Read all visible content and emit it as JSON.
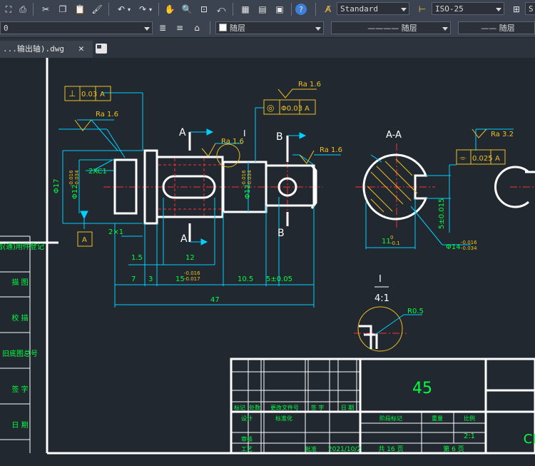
{
  "toolbar": {
    "text_style": "Standard",
    "dim_style": "ISO-25",
    "table_style_partial": "S"
  },
  "props": {
    "layer": "0",
    "color": "随层",
    "linetype": "———— 随层",
    "lineweight": "—— 随层"
  },
  "tab": {
    "filename": "...输出轴).dwg"
  },
  "drawing": {
    "tol_perp": "0.03",
    "tol_perp_ref": "A",
    "tol_conc": "Φ0.03",
    "tol_conc_ref": "A",
    "tol_sym": "0.025",
    "tol_sym_ref": "A",
    "ra_1": "Ra 1.6",
    "ra_2": "Ra 1.6",
    "ra_3": "Ra 1.6",
    "ra_4": "Ra 1.6",
    "ra_5": "Ra 3.2",
    "chamfer": "2XC1",
    "dia17": "Φ17",
    "dia12a": "Φ12",
    "dia12a_tol_up": "-0.016",
    "dia12a_tol_low": "-0.034",
    "dia12b": "Φ12",
    "dia12b_tol_up": "-0.016",
    "dia12b_tol_low": "-0.034",
    "datum_a": "A",
    "dim_2x1": "2×1",
    "dim_1_5": "1.5",
    "dim_12": "12",
    "dim_7": "7",
    "dim_3": "3",
    "dim_15": "15",
    "dim_15_tol_up": "-0.016",
    "dim_15_tol_low": "-0.017",
    "dim_10_5": "10.5",
    "dim_5": "5±0.05",
    "dim_47": "47",
    "sec_a_top": "A",
    "sec_a_bot": "A",
    "sec_b_top": "B",
    "sec_b_bot": "B",
    "detail_mark": "I",
    "section_title": "A-A",
    "dim_11": "11",
    "dim_11_tol_up": "0",
    "dim_11_tol_low": "-0.1",
    "dim_5_015": "5±0.015",
    "dim_14": "Φ14",
    "dim_14_tol_up": "-0.016",
    "dim_14_tol_low": "-0.034",
    "detail_title": "I",
    "detail_scale": "4:1",
    "detail_r": "R0.5"
  },
  "side_table": [
    "借(通)用件登记",
    "描 图",
    "校 描",
    "旧底图总号",
    "签 字",
    "日 期"
  ],
  "title_block": {
    "material": "45",
    "h_biaoji": "标记",
    "h_chushu": "处数",
    "h_fenqu": "更改文件号",
    "h_qianzi": "签 字",
    "h_riqi": "日 期",
    "sheji": "设计",
    "biaozhunhua": "标准化",
    "jieduan": "阶段标记",
    "zhongliang": "重量",
    "bili": "比例",
    "scale": "2:1",
    "shenhe": "审核",
    "gongyi": "工艺",
    "pizhun": "批准",
    "date": "2021/10/2",
    "gong": "共 16 页",
    "di": "第 6 页",
    "code_partial": "CL"
  }
}
